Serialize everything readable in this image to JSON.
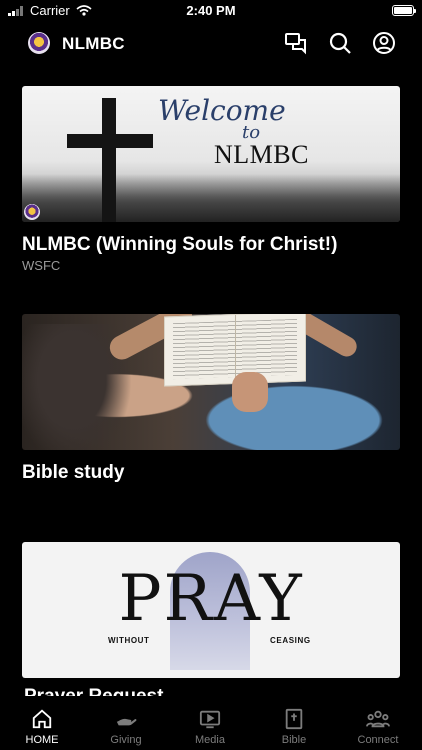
{
  "status_bar": {
    "carrier": "Carrier",
    "time": "2:40 PM"
  },
  "header": {
    "title": "NLMBC"
  },
  "cards": [
    {
      "title": "NLMBC (Winning Souls for Christ!)",
      "subtitle": "WSFC",
      "image_text": {
        "welcome": "Welcome",
        "to": "to",
        "name": "NLMBC"
      }
    },
    {
      "title": "Bible study"
    },
    {
      "title": "Prayer Request",
      "image_text": {
        "big": "PRAY",
        "left": "WITHOUT",
        "right": "CEASING"
      }
    }
  ],
  "tabs": [
    {
      "label": "HOME",
      "icon": "home-icon",
      "active": true
    },
    {
      "label": "Giving",
      "icon": "giving-hand-icon"
    },
    {
      "label": "Media",
      "icon": "media-play-icon"
    },
    {
      "label": "Bible",
      "icon": "bible-book-icon"
    },
    {
      "label": "Connect",
      "icon": "connect-people-icon"
    }
  ]
}
